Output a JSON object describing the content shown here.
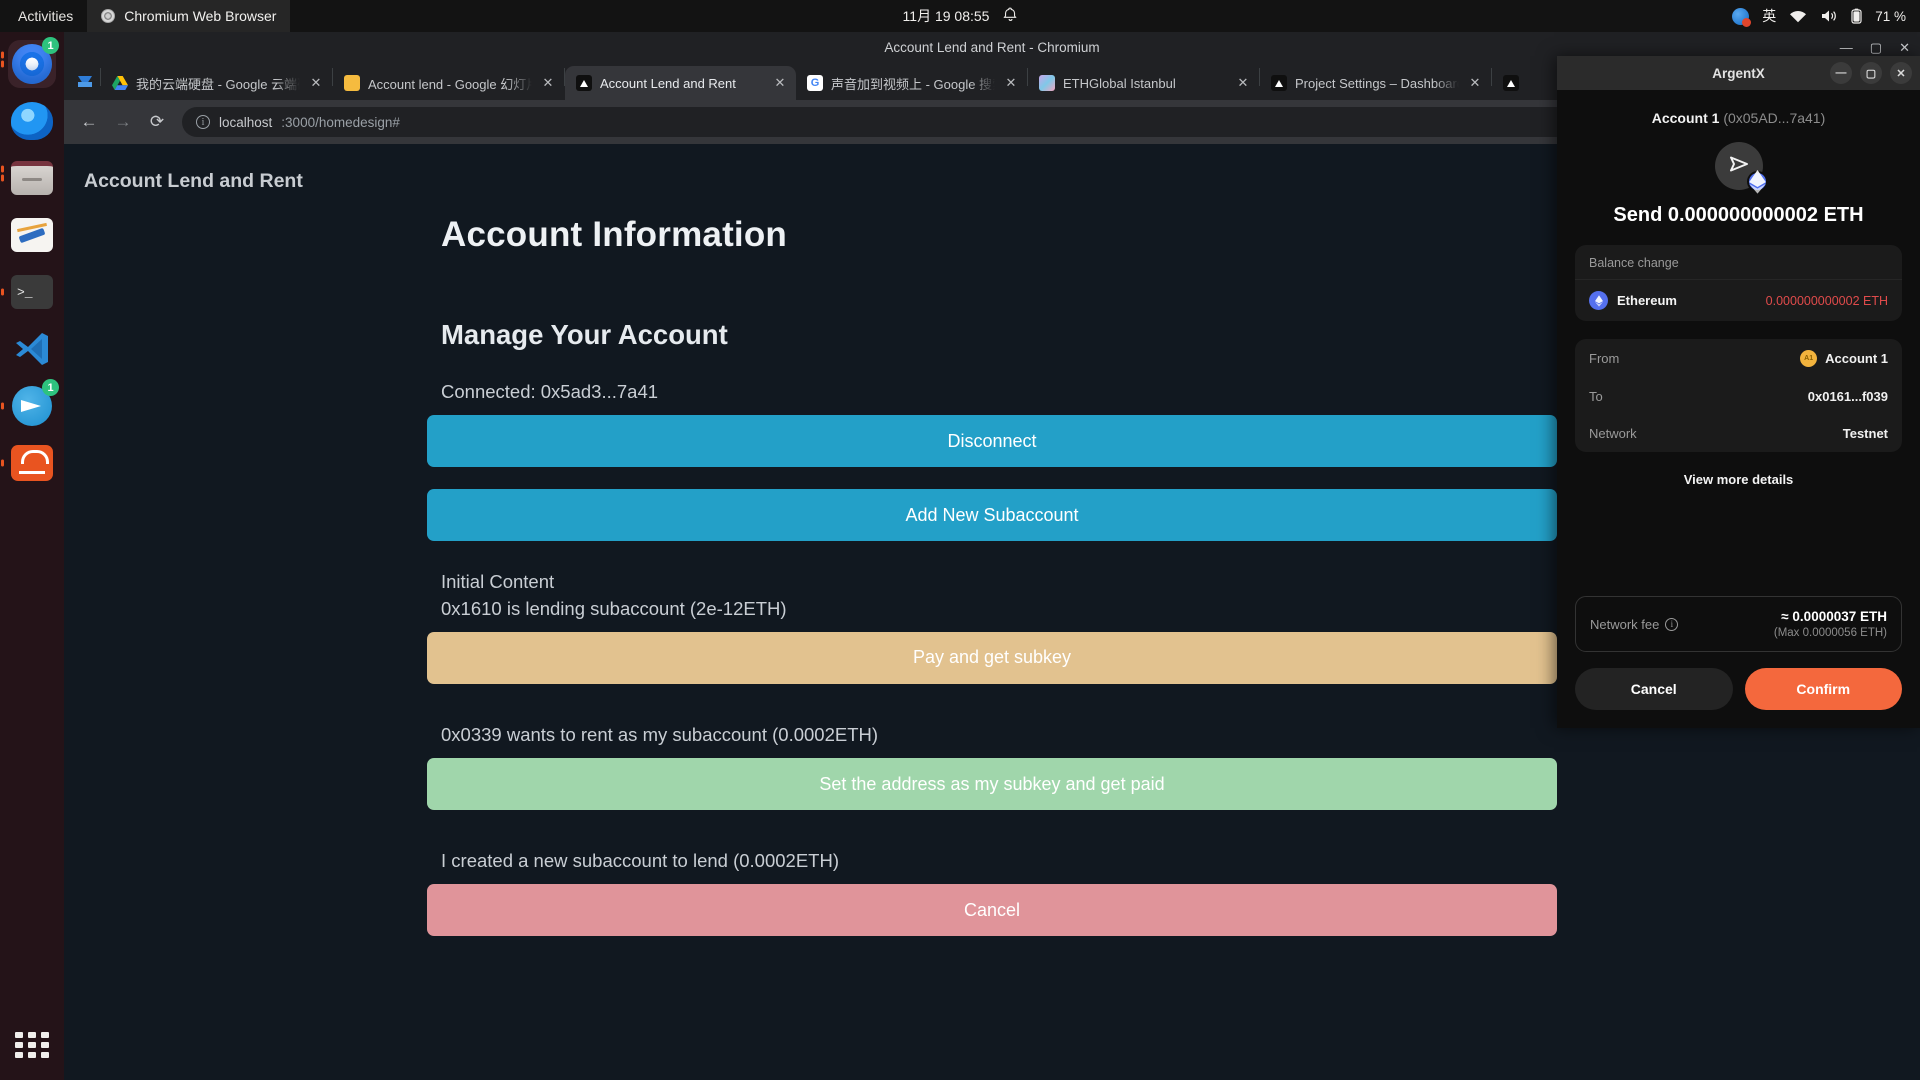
{
  "gnome": {
    "activities": "Activities",
    "app_name": "Chromium Web Browser",
    "clock": "11月 19  08:55",
    "bell_icon": "bell-icon",
    "input_source": "英",
    "battery": "71 %"
  },
  "dock": {
    "items": [
      {
        "name": "chromium",
        "badge": "1",
        "active": true
      },
      {
        "name": "thunderbird",
        "badge": "",
        "active": false
      },
      {
        "name": "files",
        "badge": "",
        "active": false
      },
      {
        "name": "text-editor",
        "badge": "",
        "active": false
      },
      {
        "name": "terminal",
        "badge": "",
        "active": false
      },
      {
        "name": "vscode",
        "badge": "",
        "active": false
      },
      {
        "name": "telegram",
        "badge": "1",
        "active": false
      },
      {
        "name": "ubuntu-software",
        "badge": "",
        "active": false
      }
    ],
    "show_apps": "show-applications"
  },
  "browser": {
    "window_title": "Account Lend and Rent - Chromium",
    "window_buttons": {
      "minimize": "—",
      "maximize": "▢",
      "close": "✕"
    },
    "tabs": [
      {
        "label": "我的云端硬盘 - Google 云端硬盘",
        "favicon": "drive-icon",
        "active": false
      },
      {
        "label": "Account lend - Google 幻灯片",
        "favicon": "slides-icon",
        "active": false
      },
      {
        "label": "Account Lend and Rent",
        "favicon": "triangle-icon",
        "active": true
      },
      {
        "label": "声音加到视频上 - Google 搜索",
        "favicon": "google-icon",
        "active": false
      },
      {
        "label": "ETHGlobal Istanbul",
        "favicon": "ethglobal-icon",
        "active": false
      },
      {
        "label": "Project Settings – Dashboard",
        "favicon": "triangle-icon",
        "active": false
      }
    ],
    "tab_close_label": "✕",
    "toolbar": {
      "back": "←",
      "forward": "→",
      "reload": "⟳",
      "url_host": "localhost",
      "url_path": ":3000/homedesign#",
      "share": "share-icon",
      "bookmark": "star-icon",
      "extension": "G"
    }
  },
  "page": {
    "site_header": "Account Lend and Rent",
    "title": "Account Information",
    "subtitle": "Manage Your Account",
    "connected_label": "Connected: 0x5ad3...7a41",
    "disconnect_button": "Disconnect",
    "add_subaccount_button": "Add New Subaccount",
    "initial_content_label": "Initial Content",
    "lending_label": "0x1610 is lending subaccount (2e-12ETH)",
    "pay_button": "Pay and get subkey",
    "rent_request_label": "0x0339 wants to rent as my subaccount (0.0002ETH)",
    "set_address_button": "Set the address as my subkey and get paid",
    "created_subaccount_label": "I created a new subaccount to lend (0.0002ETH)",
    "cancel_button": "Cancel"
  },
  "argentx": {
    "window_title": "ArgentX",
    "window_buttons": {
      "minimize": "—",
      "maximize": "▢",
      "close": "✕"
    },
    "account_name": "Account 1",
    "account_address": "(0x05AD...7a41)",
    "send_title": "Send 0.000000000002 ETH",
    "balance_change_label": "Balance change",
    "token_name": "Ethereum",
    "token_amount": "0.000000000002 ETH",
    "details": [
      {
        "key": "From",
        "value": "Account 1",
        "avatar": "A1"
      },
      {
        "key": "To",
        "value": "0x0161...f039",
        "avatar": ""
      },
      {
        "key": "Network",
        "value": "Testnet",
        "avatar": ""
      }
    ],
    "view_more": "View more details",
    "fee_label": "Network fee",
    "fee_value": "≈ 0.0000037 ETH",
    "fee_max": "(Max 0.0000056 ETH)",
    "cancel_button": "Cancel",
    "confirm_button": "Confirm",
    "accent_color": "#f4683d",
    "negative_color": "#e04b4b"
  }
}
